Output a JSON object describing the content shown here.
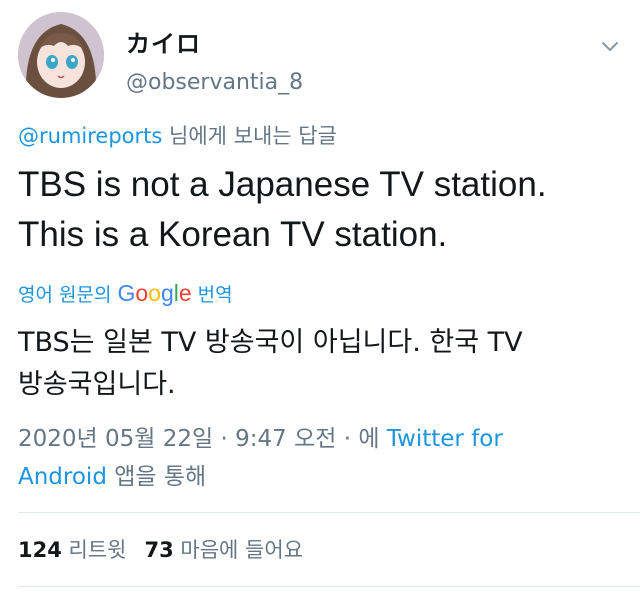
{
  "user": {
    "display_name": "カイロ",
    "handle": "@observantia_8"
  },
  "reply": {
    "mention": "@rumireports",
    "suffix": " 님에게 보내는 답글"
  },
  "tweet": {
    "line1": "TBS is not a Japanese TV station.",
    "line2": "This is a Korean TV station."
  },
  "translation": {
    "prefix": "영어 원문의",
    "google": "Google",
    "suffix": "번역",
    "line1": "TBS는 일본 TV 방송국이 아닙니다. 한국 TV",
    "line2": "방송국입니다."
  },
  "meta": {
    "datetime": "2020년 05월 22일 · 9:47 오전 · 에 ",
    "source_part1": "Twitter for",
    "source_part2": "Android",
    "suffix": " 앱을 통해"
  },
  "stats": {
    "retweets_count": "124",
    "retweets_label": "리트윗",
    "likes_count": "73",
    "likes_label": "마음에 들어요"
  },
  "colors": {
    "link": "#1b95e0",
    "secondary": "#657786",
    "primary": "#14171a"
  },
  "icons": {
    "chevron": "chevron-down-icon"
  }
}
